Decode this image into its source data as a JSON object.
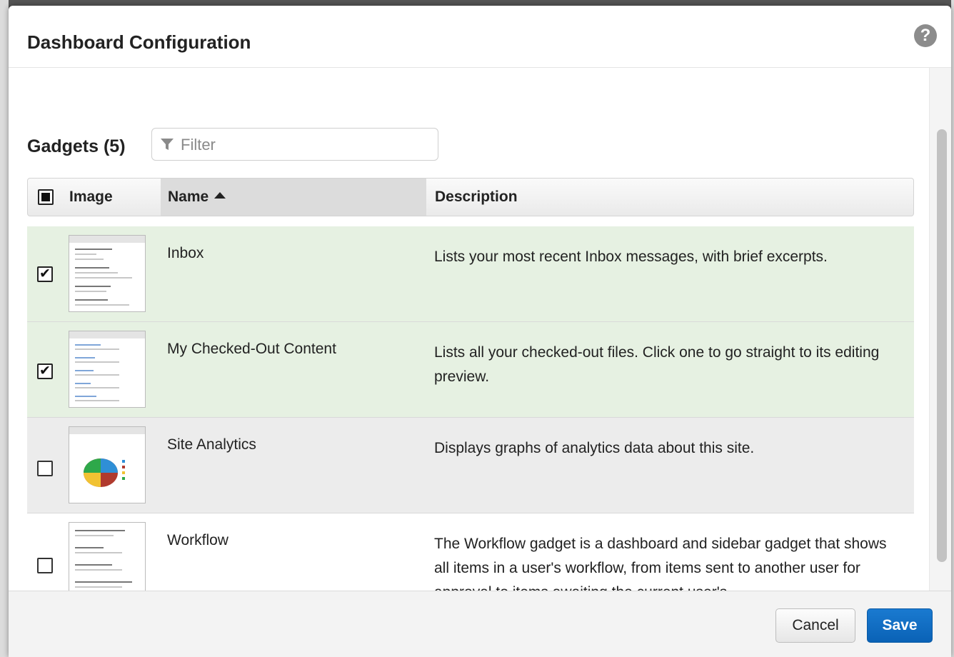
{
  "modal": {
    "title": "Dashboard Configuration",
    "help_icon": "question-circle-icon"
  },
  "gadgets": {
    "heading": "Gadgets (5)",
    "filter_placeholder": "Filter",
    "filter_icon": "funnel-icon"
  },
  "table": {
    "headers": {
      "image": "Image",
      "name": "Name",
      "description": "Description"
    },
    "sort": {
      "column": "Name",
      "direction": "ascending"
    },
    "rows": [
      {
        "name": "Inbox",
        "description": "Lists your most recent Inbox messages, with brief excerpts.",
        "checked": true,
        "thumbnail": "inbox-preview"
      },
      {
        "name": "My Checked-Out Content",
        "description": "Lists all your checked-out files. Click one to go straight to its editing preview.",
        "checked": true,
        "thumbnail": "checked-out-preview"
      },
      {
        "name": "Site Analytics",
        "description": "Displays graphs of analytics data about this site.",
        "checked": false,
        "thumbnail": "analytics-preview"
      },
      {
        "name": "Workflow",
        "description": "The Workflow gadget is a dashboard and sidebar gadget that shows all items in a user's workflow, from items sent to another user for approval to items awaiting the current user's",
        "checked": false,
        "thumbnail": "workflow-preview"
      }
    ]
  },
  "footer": {
    "cancel_label": "Cancel",
    "save_label": "Save"
  },
  "colors": {
    "selected_row": "#e6f1e2",
    "save_button": "#0a6ac4"
  }
}
